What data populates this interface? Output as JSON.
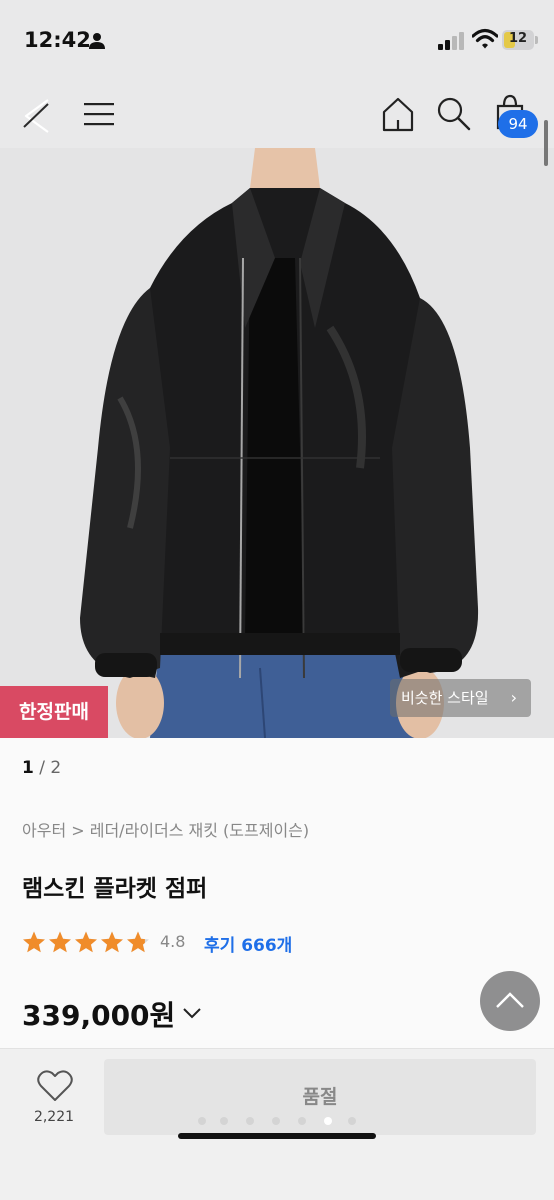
{
  "status_bar": {
    "time": "12:42",
    "battery_text": "12",
    "icons": [
      "person-icon",
      "signal-icon",
      "wifi-icon",
      "battery-icon"
    ]
  },
  "header": {
    "icons": [
      "back-icon",
      "menu-icon",
      "home-icon",
      "search-icon",
      "shopping-bag-icon"
    ],
    "cart_count": "94"
  },
  "gallery": {
    "badge": "한정판매",
    "similar_style": "비슷한 스타일",
    "chevron": "›",
    "current": "1",
    "total": "/ 2"
  },
  "product": {
    "category_path": "아우터 > 레더/라이더스 재킷 (도프제이슨)",
    "title": "램스킨 플라켓 점퍼",
    "rating": 4.8,
    "rating_text": "4.8",
    "review_count": "후기 666개",
    "price": "339,000원"
  },
  "bottom_bar": {
    "like_count": "2,221",
    "purchase_button": "품절"
  },
  "colors": {
    "accent_blue": "#1f6fe8",
    "limited_badge": "#d94a63",
    "star": "#f08c2a"
  }
}
